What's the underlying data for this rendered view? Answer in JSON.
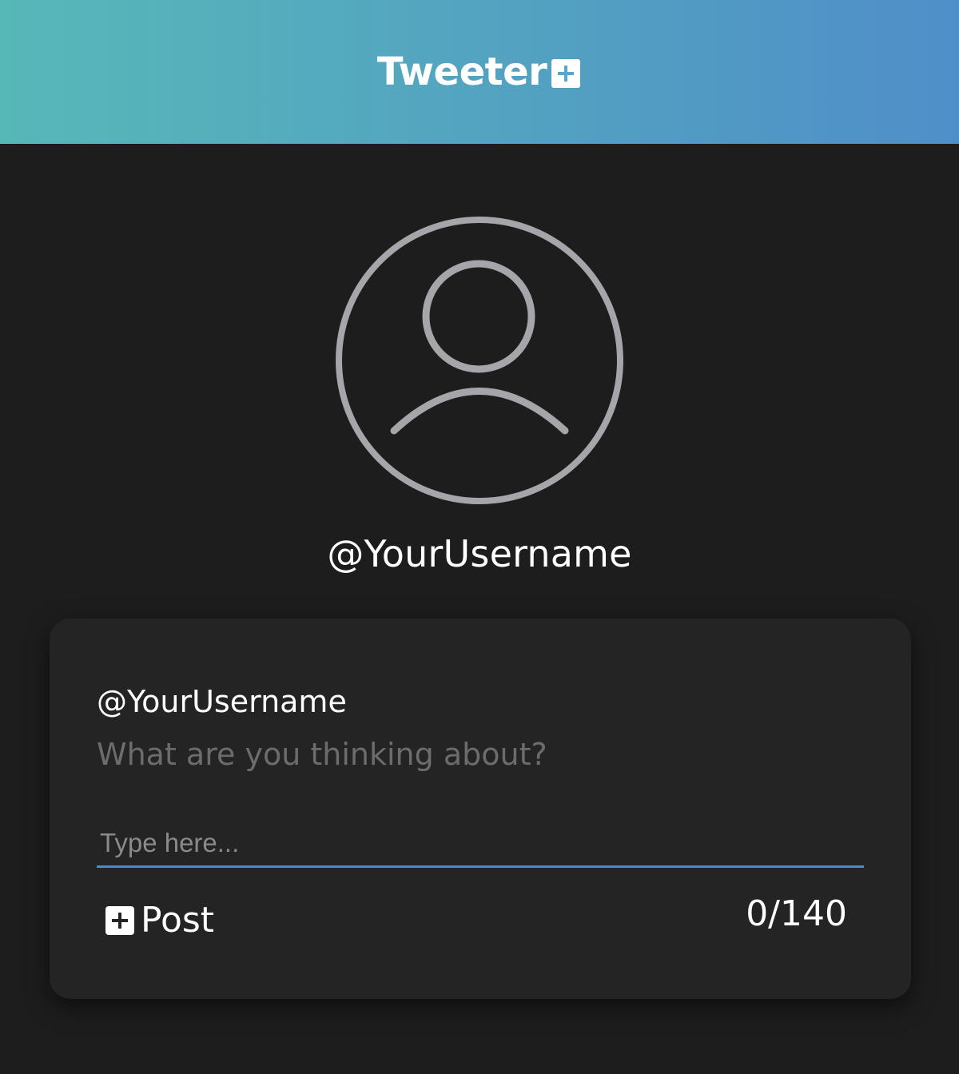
{
  "header": {
    "brand": "Tweeter",
    "brand_icon": "plus-square-icon",
    "gradient_start": "#57b8b8",
    "gradient_end": "#4f8fc9"
  },
  "profile": {
    "avatar_icon": "user-avatar-icon",
    "username": "@YourUsername"
  },
  "composer": {
    "username": "@YourUsername",
    "prompt": "What are you thinking about?",
    "input_placeholder": "Type here...",
    "input_value": "",
    "post_label": "Post",
    "post_icon": "plus-square-icon",
    "char_count": "0/140",
    "accent": "#4a8bd4"
  },
  "colors": {
    "background": "#1d1d1d",
    "card": "#242424",
    "avatar_stroke": "#a6a6aa",
    "prompt_text": "#6c6c6c"
  }
}
